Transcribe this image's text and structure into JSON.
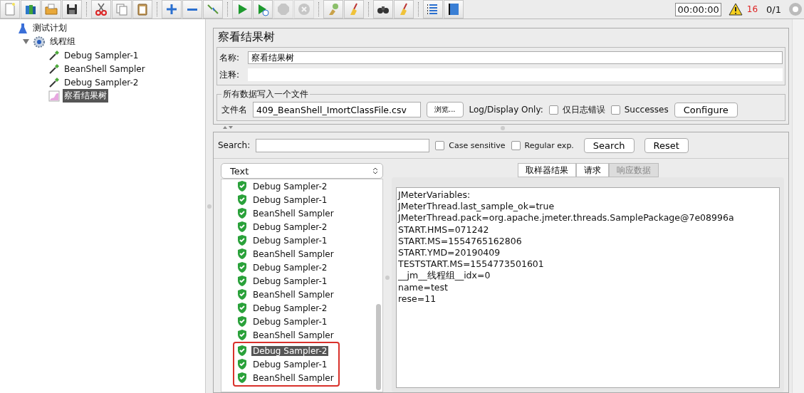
{
  "toolbar": [
    {
      "disabled": false
    },
    {
      "disabled": false
    },
    {
      "disabled": false
    },
    {
      "disabled": false
    },
    {
      "disabled": false
    },
    {
      "disabled": false
    },
    {
      "disabled": false
    },
    {
      "disabled": false
    },
    {
      "disabled": false
    },
    {
      "disabled": false
    },
    {
      "disabled": false
    },
    {
      "disabled": false
    },
    {
      "disabled": true
    },
    {
      "disabled": true
    },
    {
      "disabled": false
    },
    {
      "disabled": false
    },
    {
      "disabled": false
    },
    {
      "disabled": false
    },
    {
      "disabled": false
    },
    {
      "disabled": false
    }
  ],
  "status": {
    "timer": "00:00:00",
    "warnings": "16",
    "threads": "0/1"
  },
  "tree": [
    {
      "label": "测试计划",
      "kind": "plan",
      "selected": false,
      "children": [
        {
          "label": "线程组",
          "kind": "group",
          "selected": false,
          "expanded": true,
          "children": [
            {
              "label": "Debug Sampler-1",
              "kind": "sampler",
              "selected": false
            },
            {
              "label": "BeanShell Sampler",
              "kind": "sampler",
              "selected": false
            },
            {
              "label": "Debug Sampler-2",
              "kind": "sampler",
              "selected": false
            },
            {
              "label": "察看结果树",
              "kind": "listener",
              "selected": true
            }
          ]
        }
      ]
    }
  ],
  "panel": {
    "title": "察看结果树",
    "name_label": "名称:",
    "name_value": "察看结果树",
    "comment_label": "注释:",
    "file_group": {
      "legend": "所有数据写入一个文件",
      "file_label": "文件名",
      "file_value": "409_BeanShell_ImortClassFile.csv",
      "browse": "浏览...",
      "log_label": "Log/Display Only:",
      "options": [
        {
          "label": "仅日志错误",
          "checked": false
        },
        {
          "label": "Successes",
          "checked": false
        }
      ],
      "configure": "Configure"
    },
    "search": {
      "label": "Search:",
      "options": [
        {
          "label": "Case sensitive",
          "checked": false
        },
        {
          "label": "Regular exp.",
          "checked": false
        }
      ],
      "search_button": "Search",
      "reset_button": "Reset"
    },
    "renderer": "Text",
    "results": {
      "items": [
        {
          "label": "Debug Sampler-2",
          "selected": false
        },
        {
          "label": "Debug Sampler-1",
          "selected": false
        },
        {
          "label": "BeanShell Sampler",
          "selected": false
        },
        {
          "label": "Debug Sampler-2",
          "selected": false
        },
        {
          "label": "Debug Sampler-1",
          "selected": false
        },
        {
          "label": "BeanShell Sampler",
          "selected": false
        },
        {
          "label": "Debug Sampler-2",
          "selected": false
        },
        {
          "label": "Debug Sampler-1",
          "selected": false
        },
        {
          "label": "BeanShell Sampler",
          "selected": false
        },
        {
          "label": "Debug Sampler-2",
          "selected": false
        },
        {
          "label": "Debug Sampler-1",
          "selected": false
        },
        {
          "label": "BeanShell Sampler",
          "selected": false
        }
      ],
      "highlighted": [
        {
          "label": "Debug Sampler-2",
          "selected": true
        },
        {
          "label": "Debug Sampler-1",
          "selected": false
        },
        {
          "label": "BeanShell Sampler",
          "selected": false
        }
      ]
    },
    "tabs": [
      {
        "label": "取样器结果",
        "selected": false
      },
      {
        "label": "请求",
        "selected": false
      },
      {
        "label": "响应数据",
        "selected": true
      }
    ],
    "response_lines": [
      "JMeterVariables:",
      "JMeterThread.last_sample_ok=true",
      "JMeterThread.pack=org.apache.jmeter.threads.SamplePackage@7e08996a",
      "START.HMS=071242",
      "START.MS=1554765162806",
      "START.YMD=20190409",
      "TESTSTART.MS=1554773501601",
      "__jm__线程组__idx=0",
      "name=test",
      "rese=11"
    ]
  }
}
